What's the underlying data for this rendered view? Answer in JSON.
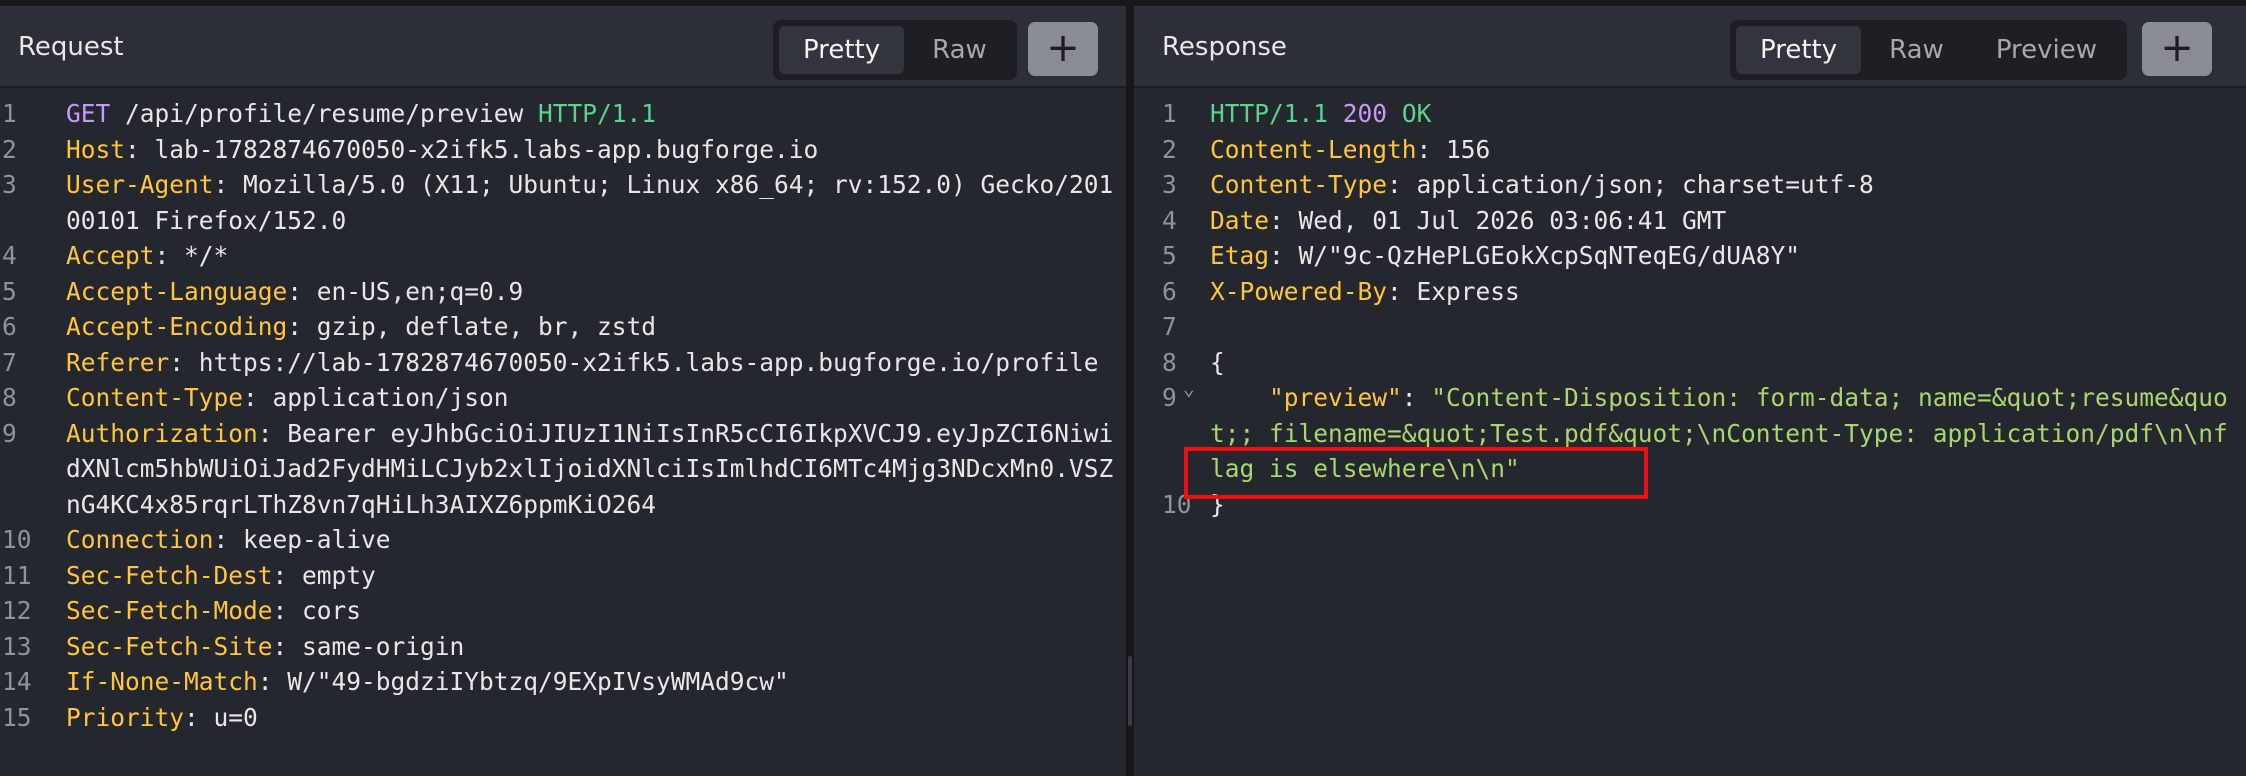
{
  "request": {
    "title": "Request",
    "tabs": [
      {
        "label": "Pretty",
        "active": true
      },
      {
        "label": "Raw",
        "active": false
      }
    ],
    "add_label": "+",
    "lines": [
      {
        "n": "1",
        "method": "GET",
        "path": " /api/profile/resume/preview ",
        "proto": "HTTP/1.1"
      },
      {
        "n": "2",
        "name": "Host",
        "value": "lab-1782874670050-x2ifk5.labs-app.bugforge.io"
      },
      {
        "n": "3",
        "name": "User-Agent",
        "value": "Mozilla/5.0 (X11; Ubuntu; Linux x86_64; rv:152.0) Gecko/20100101 Firefox/152.0"
      },
      {
        "n": "4",
        "name": "Accept",
        "value": "*/*"
      },
      {
        "n": "5",
        "name": "Accept-Language",
        "value": "en-US,en;q=0.9"
      },
      {
        "n": "6",
        "name": "Accept-Encoding",
        "value": "gzip, deflate, br, zstd"
      },
      {
        "n": "7",
        "name": "Referer",
        "value": "https://lab-1782874670050-x2ifk5.labs-app.bugforge.io/profile"
      },
      {
        "n": "8",
        "name": "Content-Type",
        "value": "application/json"
      },
      {
        "n": "9",
        "name": "Authorization",
        "value": "Bearer eyJhbGciOiJIUzI1NiIsInR5cCI6IkpXVCJ9.eyJpZCI6NiwidXNlcm5hbWUiOiJad2FydHMiLCJyb2xlIjoidXNlciIsImlhdCI6MTc4Mjg3NDcxMn0.VSZnG4KC4x85rqrLThZ8vn7qHiLh3AIXZ6ppmKiO264"
      },
      {
        "n": "10",
        "name": "Connection",
        "value": "keep-alive"
      },
      {
        "n": "11",
        "name": "Sec-Fetch-Dest",
        "value": "empty"
      },
      {
        "n": "12",
        "name": "Sec-Fetch-Mode",
        "value": "cors"
      },
      {
        "n": "13",
        "name": "Sec-Fetch-Site",
        "value": "same-origin"
      },
      {
        "n": "14",
        "name": "If-None-Match",
        "value": "W/\"49-bgdziIYbtzq/9EXpIVsyWMAd9cw\""
      },
      {
        "n": "15",
        "name": "Priority",
        "value": "u=0"
      }
    ]
  },
  "response": {
    "title": "Response",
    "tabs": [
      {
        "label": "Pretty",
        "active": true
      },
      {
        "label": "Raw",
        "active": false
      },
      {
        "label": "Preview",
        "active": false
      }
    ],
    "add_label": "+",
    "status": {
      "n": "1",
      "proto": "HTTP/1.1",
      "code": "200",
      "text": "OK"
    },
    "headers": [
      {
        "n": "2",
        "name": "Content-Length",
        "value": "156"
      },
      {
        "n": "3",
        "name": "Content-Type",
        "value": "application/json; charset=utf-8"
      },
      {
        "n": "4",
        "name": "Date",
        "value": "Wed, 01 Jul 2026 03:06:41 GMT"
      },
      {
        "n": "5",
        "name": "Etag",
        "value": "W/\"9c-QzHePLGEokXcpSqNTeqEG/dUA8Y\""
      },
      {
        "n": "6",
        "name": "X-Powered-By",
        "value": "Express"
      }
    ],
    "blank_n": "7",
    "open_n": "8",
    "open_brace": "{",
    "fold_glyph": "⌄",
    "json_n": "9",
    "json_key": "\"preview\"",
    "json_colon": ": ",
    "json_value": "\"Content-Disposition: form-data; name=&quot;resume&quot;; filename=&quot;Test.pdf&quot;\\nContent-Type: application/pdf\\n\\nflag is elsewhere\\n\\n\"",
    "json_indent": "    ",
    "close_n": "10",
    "close_brace": "}"
  },
  "colors": {
    "header_name": "#ffc53d",
    "method": "#c99af5",
    "protocol": "#5fd28a",
    "json_string": "#a9d66d",
    "highlight_box": "#ec1010"
  }
}
